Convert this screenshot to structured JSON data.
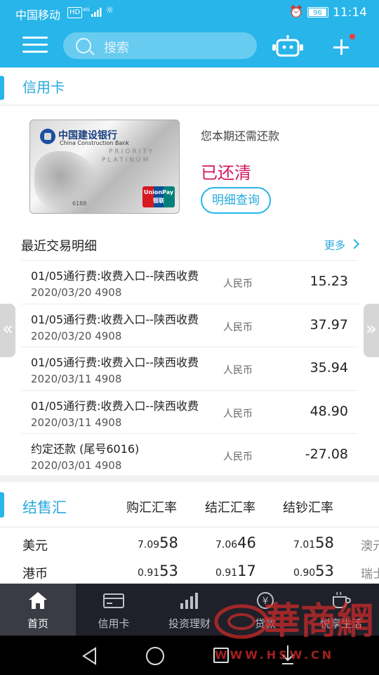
{
  "status_bar": {
    "carrier": "中国移动",
    "hd": "HD",
    "battery": "96",
    "time": "11:14"
  },
  "header": {
    "search_placeholder": "搜索"
  },
  "credit_card": {
    "section_title": "信用卡",
    "card": {
      "bank_name": "中国建设银行",
      "bank_name_en": "China Construction Bank",
      "tier_1": "PRIORITY",
      "tier_2": "PLATINUM",
      "card_number_partial": "6188",
      "network": "UnionPay",
      "network_cn": "银联"
    },
    "due_label": "您本期还需还款",
    "status": "已还清",
    "detail_button": "明细查询",
    "recent_title": "最近交易明细",
    "more_label": "更多",
    "transactions": [
      {
        "desc": "01/05通行费:收费入口--陕西收费",
        "date": "2020/03/20  4908",
        "currency": "人民币",
        "amount": "15.23"
      },
      {
        "desc": "01/05通行费:收费入口--陕西收费",
        "date": "2020/03/20  4908",
        "currency": "人民币",
        "amount": "37.97"
      },
      {
        "desc": "01/05通行费:收费入口--陕西收费",
        "date": "2020/03/11  4908",
        "currency": "人民币",
        "amount": "35.94"
      },
      {
        "desc": "01/05通行费:收费入口--陕西收费",
        "date": "2020/03/11  4908",
        "currency": "人民币",
        "amount": "48.90"
      },
      {
        "desc": "约定还款 (尾号6016)",
        "date": "2020/03/01  4908",
        "currency": "人民币",
        "amount": "-27.08"
      }
    ]
  },
  "fx": {
    "title": "结售汇",
    "columns": [
      "购汇汇率",
      "结汇汇率",
      "结钞汇率"
    ],
    "rows": [
      {
        "name": "美元",
        "rates": [
          {
            "head": "7.09",
            "tail": "58"
          },
          {
            "head": "7.06",
            "tail": "46"
          },
          {
            "head": "7.01",
            "tail": "58"
          }
        ],
        "extra": "澳元"
      },
      {
        "name": "港币",
        "rates": [
          {
            "head": "0.91",
            "tail": "53"
          },
          {
            "head": "0.91",
            "tail": "17"
          },
          {
            "head": "0.90",
            "tail": "53"
          }
        ],
        "extra": "瑞士"
      }
    ]
  },
  "bottom_nav": [
    {
      "label": "首页",
      "icon": "home-icon",
      "active": true
    },
    {
      "label": "信用卡",
      "icon": "card-icon",
      "active": false
    },
    {
      "label": "投资理财",
      "icon": "bar-chart-icon",
      "active": false
    },
    {
      "label": "贷款",
      "icon": "yen-coin-icon",
      "active": false
    },
    {
      "label": "悦享生活",
      "icon": "cup-icon",
      "active": false
    }
  ],
  "watermark": {
    "brand": "華商網",
    "url": "WWW.HSW.CN"
  },
  "colors": {
    "primary": "#27b5ea",
    "paid": "#d4175f",
    "nav_bg": "#1f2029",
    "watermark": "#cc2a2a"
  }
}
